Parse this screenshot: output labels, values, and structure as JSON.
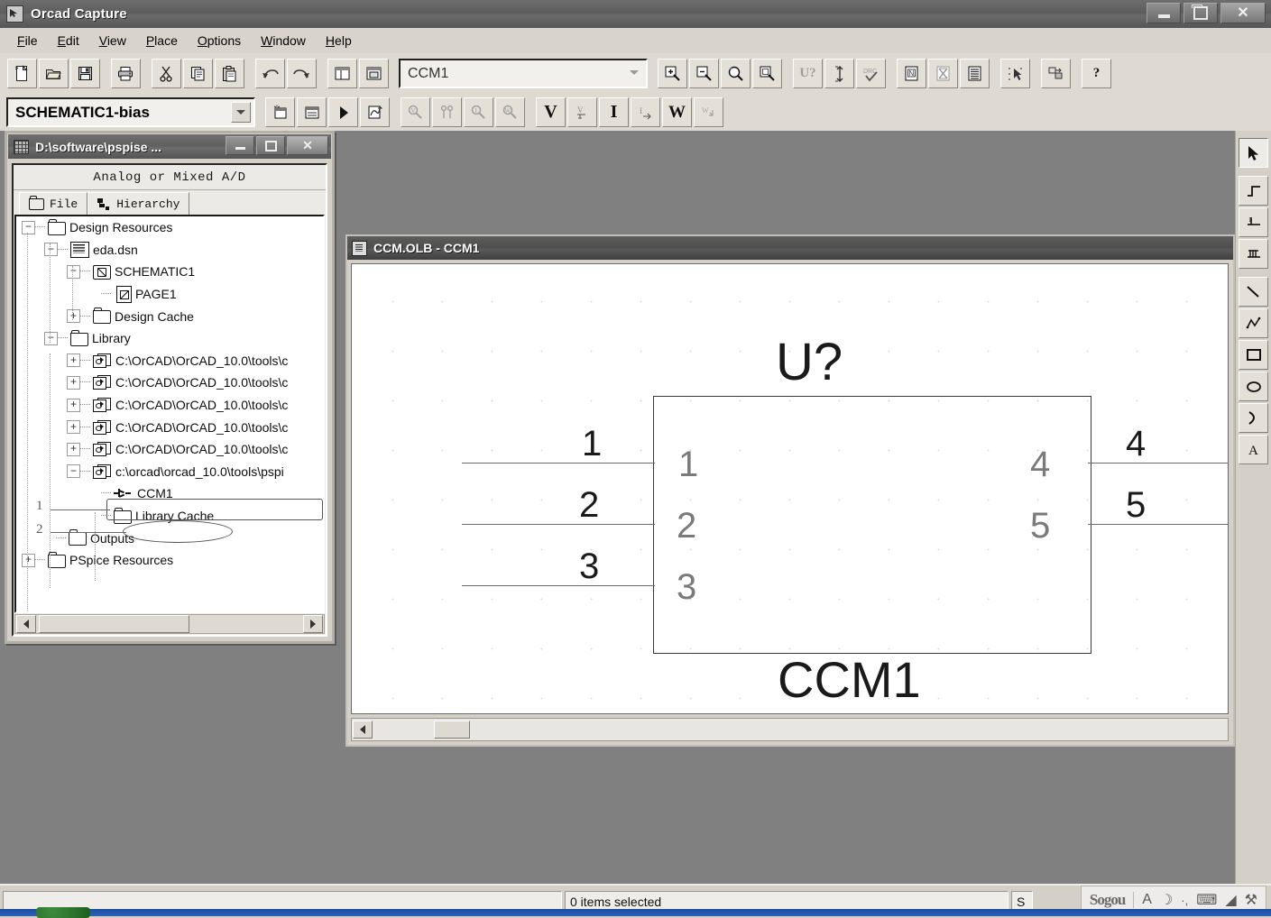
{
  "window": {
    "title": "Orcad Capture",
    "icon": "capture-app-icon",
    "min_label": "",
    "max_label": "",
    "close_label": "✕"
  },
  "menu": [
    {
      "label": "File",
      "accel": "F"
    },
    {
      "label": "Edit",
      "accel": "E"
    },
    {
      "label": "View",
      "accel": "V"
    },
    {
      "label": "Place",
      "accel": "P"
    },
    {
      "label": "Options",
      "accel": "O"
    },
    {
      "label": "Window",
      "accel": "W"
    },
    {
      "label": "Help",
      "accel": "H"
    }
  ],
  "toolbar_row1": {
    "buttons": [
      {
        "name": "new-button",
        "icon": "new-document-icon"
      },
      {
        "name": "open-button",
        "icon": "open-folder-icon"
      },
      {
        "name": "save-button",
        "icon": "floppy-save-icon"
      },
      {
        "name": "print-button",
        "icon": "printer-icon"
      },
      {
        "name": "cut-button",
        "icon": "scissors-icon"
      },
      {
        "name": "copy-button",
        "icon": "copy-pages-icon"
      },
      {
        "name": "paste-button",
        "icon": "clipboard-paste-icon"
      },
      {
        "name": "undo-button",
        "icon": "undo-arrow-icon"
      },
      {
        "name": "redo-button",
        "icon": "redo-arrow-icon"
      },
      {
        "name": "project-manager-button",
        "icon": "split-window-icon"
      },
      {
        "name": "new-window-button",
        "icon": "cascade-window-icon"
      }
    ],
    "part_combo": {
      "name": "part-name-combo",
      "value": "CCM1"
    },
    "zoom_buttons": [
      {
        "name": "zoom-in-button",
        "icon": "zoom-in-icon"
      },
      {
        "name": "zoom-out-button",
        "icon": "zoom-out-icon"
      },
      {
        "name": "zoom-area-button",
        "icon": "zoom-area-icon"
      },
      {
        "name": "zoom-fit-button",
        "icon": "zoom-fit-icon"
      }
    ],
    "annotate_buttons": [
      {
        "name": "annotate-button",
        "icon": "u-question-icon",
        "label": "U?"
      },
      {
        "name": "backannotate-button",
        "icon": "updown-arrow-icon"
      },
      {
        "name": "drc-button",
        "icon": "drc-check-icon",
        "label": "DRC"
      },
      {
        "name": "create-netlist-button",
        "icon": "netlist-icon"
      },
      {
        "name": "cross-reference-button",
        "icon": "cross-reference-icon"
      },
      {
        "name": "bill-of-materials-button",
        "icon": "bom-list-icon"
      }
    ],
    "misc_buttons": [
      {
        "name": "snap-to-grid-button",
        "icon": "snap-grid-cursor-icon"
      },
      {
        "name": "export-properties-button",
        "icon": "export-properties-icon"
      },
      {
        "name": "help-button",
        "icon": "question-mark-icon",
        "label": "?"
      }
    ]
  },
  "toolbar_row2": {
    "profile_combo": {
      "name": "simulation-profile-combo",
      "value": "SCHEMATIC1-bias"
    },
    "sim_buttons": [
      {
        "name": "new-simulation-profile-button",
        "icon": "new-sim-profile-icon"
      },
      {
        "name": "edit-simulation-profile-button",
        "icon": "edit-sim-profile-icon"
      },
      {
        "name": "run-simulation-button",
        "icon": "run-play-icon"
      },
      {
        "name": "view-simulation-results-button",
        "icon": "view-results-icon"
      }
    ],
    "marker_buttons": [
      {
        "name": "voltage-marker-button",
        "icon": "voltage-probe-icon"
      },
      {
        "name": "differential-marker-button",
        "icon": "differential-probe-icon"
      },
      {
        "name": "current-marker-button",
        "icon": "current-probe-icon"
      },
      {
        "name": "power-marker-button",
        "icon": "power-probe-icon"
      }
    ],
    "display_buttons": [
      {
        "name": "display-voltage-button",
        "icon": "letter-v-icon",
        "label": "V"
      },
      {
        "name": "display-voltage-diff-button",
        "icon": "voltage-diff-icon",
        "label": "V"
      },
      {
        "name": "display-current-button",
        "icon": "letter-i-icon",
        "label": "I"
      },
      {
        "name": "display-current-diff-button",
        "icon": "current-diff-icon",
        "label": "I"
      },
      {
        "name": "display-power-button",
        "icon": "letter-w-icon",
        "label": "W"
      },
      {
        "name": "display-power-diff-button",
        "icon": "power-diff-icon",
        "label": "W"
      }
    ]
  },
  "project_manager": {
    "title": "D:\\software\\pspise ...",
    "icon": "project-manager-icon",
    "mode_label": "Analog or Mixed A/D",
    "tabs": [
      {
        "label": "File",
        "icon": "folder-icon",
        "active": true
      },
      {
        "label": "Hierarchy",
        "icon": "hierarchy-icon",
        "active": false
      }
    ],
    "tree": [
      {
        "label": "Design Resources",
        "depth": 0,
        "expander": "-",
        "icon": "folder-icon"
      },
      {
        "label": "eda.dsn",
        "depth": 1,
        "expander": "-",
        "icon": "design-file-icon"
      },
      {
        "label": "SCHEMATIC1",
        "depth": 2,
        "expander": "-",
        "icon": "schematic-folder-icon"
      },
      {
        "label": "PAGE1",
        "depth": 3,
        "expander": "",
        "icon": "page-icon"
      },
      {
        "label": "Design Cache",
        "depth": 2,
        "expander": "+",
        "icon": "folder-icon"
      },
      {
        "label": "Library",
        "depth": 1,
        "expander": "-",
        "icon": "folder-icon"
      },
      {
        "label": "C:\\OrCAD\\OrCAD_10.0\\tools\\c",
        "depth": 2,
        "expander": "+",
        "icon": "library-icon"
      },
      {
        "label": "C:\\OrCAD\\OrCAD_10.0\\tools\\c",
        "depth": 2,
        "expander": "+",
        "icon": "library-icon"
      },
      {
        "label": "C:\\OrCAD\\OrCAD_10.0\\tools\\c",
        "depth": 2,
        "expander": "+",
        "icon": "library-icon"
      },
      {
        "label": "C:\\OrCAD\\OrCAD_10.0\\tools\\c",
        "depth": 2,
        "expander": "+",
        "icon": "library-icon"
      },
      {
        "label": "C:\\OrCAD\\OrCAD_10.0\\tools\\c",
        "depth": 2,
        "expander": "+",
        "icon": "library-icon"
      },
      {
        "label": "c:\\orcad\\orcad_10.0\\tools\\pspi",
        "depth": 2,
        "expander": "-",
        "icon": "library-icon",
        "callout": "rect"
      },
      {
        "label": "CCM1",
        "depth": 3,
        "expander": "",
        "icon": "part-icon",
        "callout": "ellipse"
      },
      {
        "label": "Library Cache",
        "depth": 3,
        "expander": "",
        "icon": "folder-icon"
      },
      {
        "label": "Outputs",
        "depth": 1,
        "expander": "",
        "icon": "folder-icon"
      },
      {
        "label": "PSpice Resources",
        "depth": 0,
        "expander": "+",
        "icon": "folder-icon"
      }
    ],
    "annotations": [
      {
        "number": "1",
        "target": "library-path-row"
      },
      {
        "number": "2",
        "target": "ccm1-part-row"
      }
    ],
    "scrollbar": {
      "name": "tree-horizontal-scrollbar"
    }
  },
  "symbol_editor": {
    "title": "CCM.OLB - CCM1",
    "icon": "symbol-editor-icon",
    "symbol": {
      "reference_designator": "U?",
      "part_value": "CCM1",
      "left_pins": [
        {
          "number": "1",
          "name": "1"
        },
        {
          "number": "2",
          "name": "2"
        },
        {
          "number": "3",
          "name": "3"
        }
      ],
      "right_pins": [
        {
          "number": "4",
          "name": "4"
        },
        {
          "number": "5",
          "name": "5"
        }
      ]
    },
    "scrollbar": {
      "name": "canvas-horizontal-scrollbar"
    }
  },
  "palette": {
    "tools": [
      {
        "name": "select-tool",
        "icon": "arrow-pointer-icon",
        "active": true
      },
      {
        "name": "pin-tool",
        "icon": "pin-icon",
        "active": false
      },
      {
        "name": "pin-array-tool",
        "icon": "pin-array-icon",
        "active": false
      },
      {
        "name": "bus-pin-tool",
        "icon": "multi-pin-icon",
        "active": false
      },
      {
        "name": "line-tool",
        "icon": "line-icon",
        "active": false
      },
      {
        "name": "polyline-tool",
        "icon": "polyline-icon",
        "active": false
      },
      {
        "name": "rectangle-tool",
        "icon": "rectangle-icon",
        "active": false
      },
      {
        "name": "ellipse-tool",
        "icon": "ellipse-icon",
        "active": false
      },
      {
        "name": "arc-tool",
        "icon": "arc-icon",
        "active": false
      },
      {
        "name": "text-tool",
        "icon": "text-a-icon",
        "active": false
      }
    ]
  },
  "status_bar": {
    "left_text": "",
    "selection_text": "0 items selected",
    "right_text": "S",
    "ime": {
      "logo": "Sogou",
      "buttons": [
        {
          "name": "ime-input-mode",
          "icon": "letter-a-icon",
          "glyph": "A"
        },
        {
          "name": "ime-moon-mode",
          "icon": "moon-icon",
          "glyph": "☽"
        },
        {
          "name": "ime-punctuation",
          "icon": "punctuation-icon",
          "glyph": "·,"
        },
        {
          "name": "ime-soft-keyboard",
          "icon": "keyboard-icon",
          "glyph": "⌨"
        },
        {
          "name": "ime-skin",
          "icon": "paint-bucket-icon",
          "glyph": "◢"
        },
        {
          "name": "ime-settings",
          "icon": "wrench-icon",
          "glyph": "⚒"
        }
      ]
    }
  },
  "colors": {
    "window_face": "#d4d0c8",
    "mdi_background": "#808080",
    "canvas": "#ffffff",
    "symbol_outline": "#3a3a3a",
    "title_active": "#5d5d5d",
    "taskbar": "#1c4e9c"
  }
}
